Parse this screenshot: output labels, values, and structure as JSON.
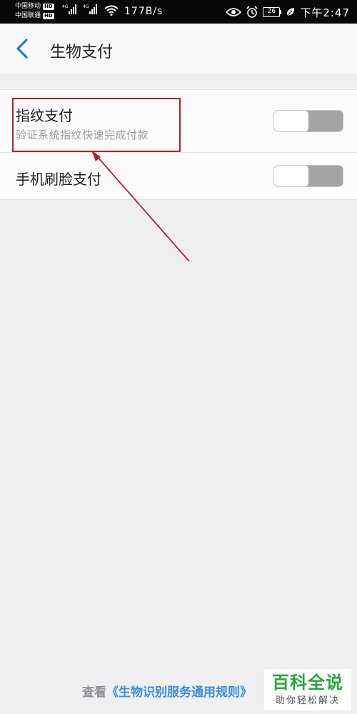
{
  "status_bar": {
    "carrier1": "中国移动",
    "carrier2": "中国联通",
    "hd": "HD",
    "network": "4G",
    "speed": "177B/s",
    "battery": "26",
    "time": "下午2:47"
  },
  "header": {
    "title": "生物支付",
    "back_icon": "chevron-left-icon"
  },
  "settings": {
    "items": [
      {
        "title": "指纹支付",
        "subtitle": "验证系统指纹快速完成付款",
        "enabled": false
      },
      {
        "title": "手机刷脸支付",
        "enabled": false
      }
    ]
  },
  "footer": {
    "prefix": "查看",
    "link": "《生物识别服务通用规则》"
  },
  "watermark": {
    "title": "百科全说",
    "subtitle": "助你轻松解决"
  },
  "colors": {
    "accent": "#1b7ee0",
    "link": "#3a8ede",
    "annotation": "#b51f2c",
    "watermark": "#23a83a"
  }
}
